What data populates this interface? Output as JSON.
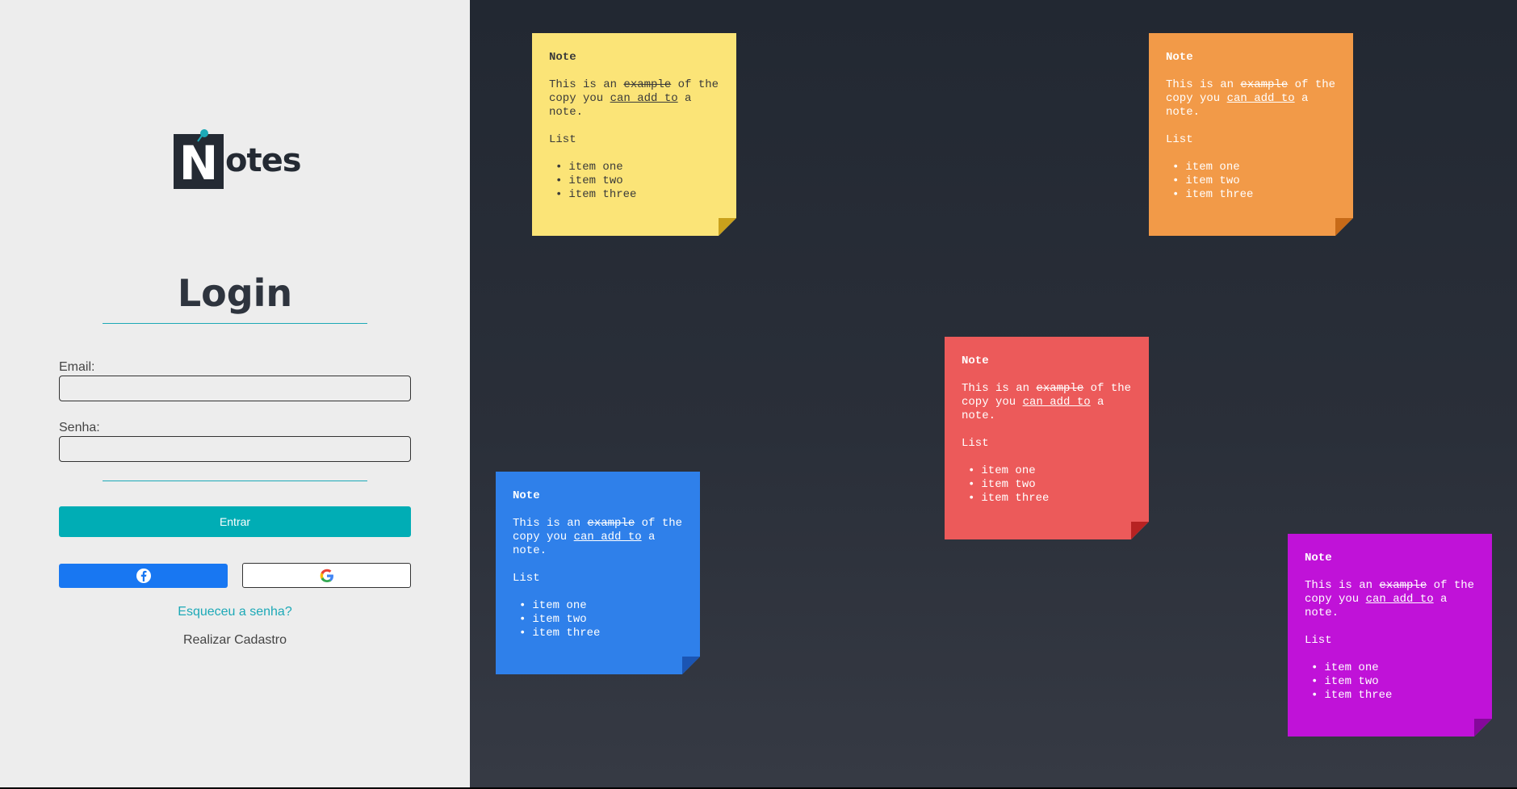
{
  "brand": {
    "logo_letter": "N",
    "logo_rest": "otes",
    "pin_color": "#1da9b7",
    "logo_box_color": "#242a33"
  },
  "login": {
    "title": "Login",
    "email_label": "Email:",
    "email_value": "",
    "password_label": "Senha:",
    "password_value": "",
    "submit_label": "Entrar",
    "facebook_icon": "facebook-icon",
    "google_icon": "google-icon",
    "forgot_link": "Esqueceu a senha?",
    "register_link": "Realizar Cadastro",
    "accent_color": "#00adb5"
  },
  "notes": [
    {
      "color": "yellow",
      "title": "Note",
      "text_a": "This is an",
      "struck": "example",
      "text_b": "of the copy you",
      "underlined": "can add to",
      "text_c": "a note.",
      "list_title": "List",
      "items": [
        "item one",
        "item two",
        "item three"
      ]
    },
    {
      "color": "orange",
      "title": "Note",
      "text_a": "This is an",
      "struck": "example",
      "text_b": "of the copy you",
      "underlined": "can add to",
      "text_c": "a note.",
      "list_title": "List",
      "items": [
        "item one",
        "item two",
        "item three"
      ]
    },
    {
      "color": "red",
      "title": "Note",
      "text_a": "This is an",
      "struck": "example",
      "text_b": "of the copy you",
      "underlined": "can add to",
      "text_c": "a note.",
      "list_title": "List",
      "items": [
        "item one",
        "item two",
        "item three"
      ]
    },
    {
      "color": "blue",
      "title": "Note",
      "text_a": "This is an",
      "struck": "example",
      "text_b": "of the copy you",
      "underlined": "can add to",
      "text_c": "a note.",
      "list_title": "List",
      "items": [
        "item one",
        "item two",
        "item three"
      ]
    },
    {
      "color": "purple",
      "title": "Note",
      "text_a": "This is an",
      "struck": "example",
      "text_b": "of the copy you",
      "underlined": "can add to",
      "text_c": "a note.",
      "list_title": "List",
      "items": [
        "item one",
        "item two",
        "item three"
      ]
    }
  ]
}
